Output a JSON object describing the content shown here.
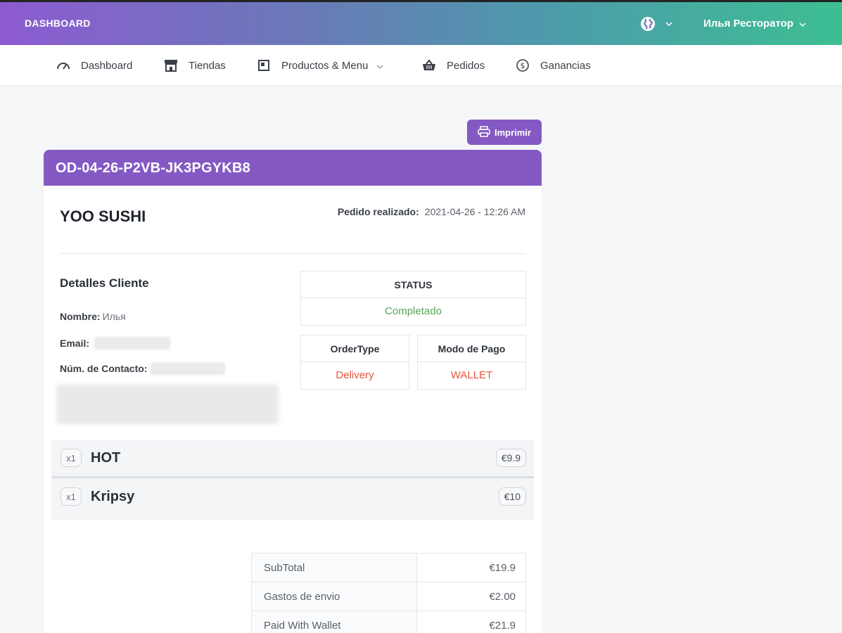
{
  "header": {
    "brand": "DASHBOARD",
    "user_name": "Илья Ресторатор",
    "globe_icon": "globe-icon"
  },
  "nav": {
    "items": [
      {
        "label": "Dashboard",
        "icon": "speedometer-icon"
      },
      {
        "label": "Tiendas",
        "icon": "store-icon"
      },
      {
        "label": "Productos & Menu",
        "icon": "product-box-icon"
      },
      {
        "label": "Pedidos",
        "icon": "basket-icon"
      },
      {
        "label": "Ganancias",
        "icon": "dollar-circle-icon"
      }
    ]
  },
  "print_label": "Imprimir",
  "order": {
    "id": "OD-04-26-P2VB-JK3PGYKB8",
    "store": "YOO SUSHI",
    "placed_label": "Pedido realizado:",
    "placed_value": "2021-04-26 - 12:26 AM"
  },
  "customer": {
    "title": "Detalles Cliente",
    "name_label": "Nombre:",
    "name_value": "Илья",
    "email_label": "Email:",
    "contact_label": "Núm. de Contacto:"
  },
  "status": {
    "label": "STATUS",
    "value": "Completado",
    "order_type_label": "OrderType",
    "order_type_value": "Delivery",
    "payment_label": "Modo de Pago",
    "payment_value": "WALLET"
  },
  "items": [
    {
      "qty": "x1",
      "name": "HOT",
      "price": "€9.9"
    },
    {
      "qty": "x1",
      "name": "Kripsy",
      "price": "€10"
    }
  ],
  "totals": [
    {
      "label": "SubTotal",
      "value": "€19.9"
    },
    {
      "label": "Gastos de envio",
      "value": "€2.00"
    },
    {
      "label": "Paid With Wallet",
      "value": "€21.9"
    }
  ],
  "colors": {
    "accent": "#8559c4",
    "success": "#56a657",
    "danger": "#e8573f"
  }
}
